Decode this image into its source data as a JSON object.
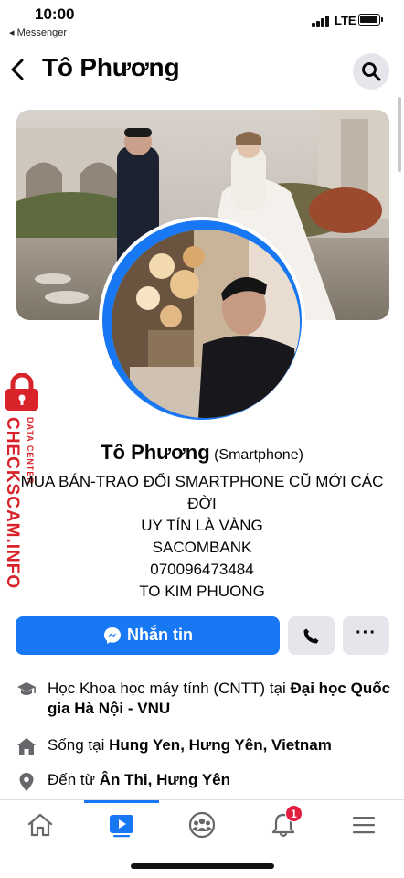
{
  "status_bar": {
    "time": "10:00",
    "back_app": "◂ Messenger",
    "network": "LTE",
    "battery_level": 0.85
  },
  "header": {
    "title": "Tô Phương",
    "back_icon": "chevron-left-icon",
    "search_icon": "search-icon"
  },
  "profile": {
    "name": "Tô Phương",
    "category": "(Smartphone)",
    "bio_lines": [
      "MUA BÁN-TRAO ĐỔI SMARTPHONE CŨ MỚI CÁC",
      "ĐỜI",
      "UY TÍN LÀ VÀNG",
      "SACOMBANK",
      "070096473484",
      "TO KIM PHUONG"
    ]
  },
  "watermark": {
    "main": "CHECKSCAM.INFO",
    "sub": "DATA CENTER"
  },
  "actions": {
    "message_label": "Nhắn tin",
    "call_icon": "phone-icon",
    "more_label": "···"
  },
  "details": {
    "education": {
      "prefix": "Học Khoa học máy tính (CNTT) tại ",
      "place": "Đại học Quốc gia Hà Nội - VNU"
    },
    "lives": {
      "prefix": "Sống tại ",
      "place": "Hung Yen, Hưng Yên, Vietnam"
    },
    "from": {
      "prefix": "Đến từ ",
      "place": "Ân Thi, Hưng Yên"
    }
  },
  "tabbar": {
    "tabs": [
      "home-icon",
      "watch-icon",
      "groups-icon",
      "notifications-icon",
      "menu-icon"
    ],
    "notification_count": "1",
    "accent": "#1877f2"
  }
}
